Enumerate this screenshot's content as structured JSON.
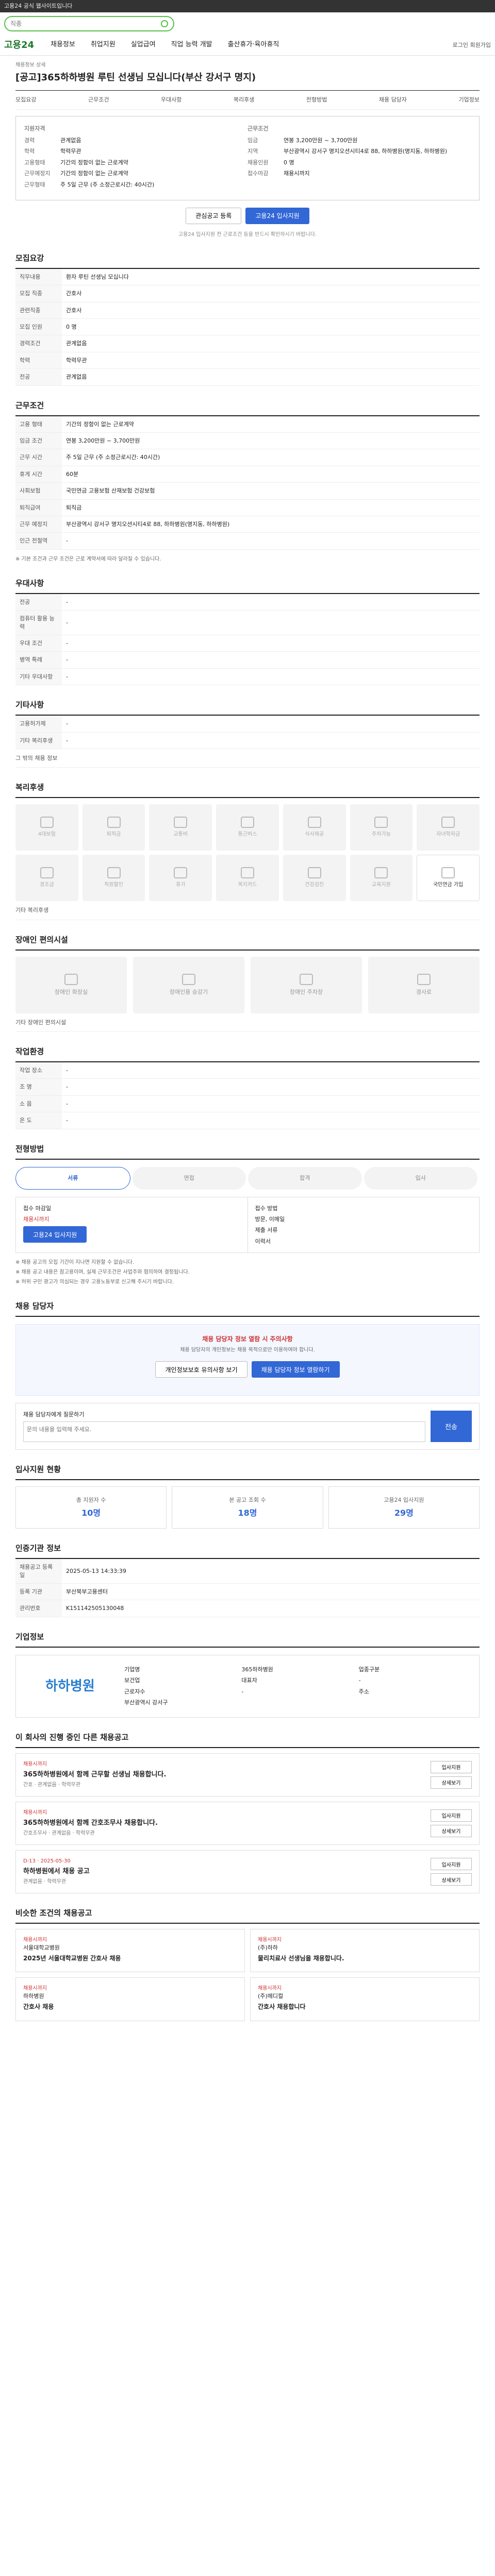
{
  "topbar": {
    "text": "고용24 공식 웹사이트입니다"
  },
  "search": {
    "placeholder": "직종"
  },
  "gnb": {
    "logo": "고용24",
    "menu": [
      "채용정보",
      "취업지원",
      "실업급여",
      "직업 능력 개발",
      "출산휴가·육아휴직"
    ],
    "right": "로그인 회원가입"
  },
  "job": {
    "category": "채용정보 상세",
    "title": "[공고]365하하병원 루틴 선생님 모십니다(부산 강서구 명지)",
    "tabs": [
      "모집요강",
      "근무조건",
      "우대사항",
      "복리후생",
      "전형방법",
      "채용 담당자",
      "기업정보"
    ]
  },
  "summary": {
    "left_title": "지원자격",
    "right_title": "근무조건",
    "left": [
      {
        "k": "경력",
        "v": "관계없음"
      },
      {
        "k": "학력",
        "v": "학력무관"
      },
      {
        "k": "고용형태",
        "v": "기간의 정함이 없는 근로계약"
      },
      {
        "k": "근무예정지",
        "v": "기간의 정함이 없는 근로계약"
      },
      {
        "k": "근무형태",
        "v": "주 5일 근무 (주 소정근로시간: 40시간)"
      }
    ],
    "right": [
      {
        "k": "임금",
        "v": "연봉 3,200만원 ~ 3,700만원"
      },
      {
        "k": "지역",
        "v": "부산광역시 강서구 명지오션시티4로 88, 하하병원(명지동, 하하병원)"
      },
      {
        "k": "채용인원",
        "v": "0 명"
      },
      {
        "k": "접수마감",
        "v": "채용시까지"
      }
    ]
  },
  "actions": {
    "scrap": "관심공고 등록",
    "apply": "고용24 입사지원"
  },
  "summary_note": "고용24 입사지원 전 근로조건 등을 반드시 확인하시기 바랍니다.",
  "recruit": {
    "heading": "모집요강",
    "rows": [
      {
        "k": "직무내용",
        "v": "환자 루틴 선생님 모십니다"
      },
      {
        "k": "모집 직종",
        "v": "간호사"
      },
      {
        "k": "관련직종",
        "v": "간호사"
      },
      {
        "k": "모집 인원",
        "v": "0 명"
      },
      {
        "k": "경력조건",
        "v": "관계없음"
      },
      {
        "k": "학력",
        "v": "학력무관"
      },
      {
        "k": "전공",
        "v": "관계없음"
      }
    ]
  },
  "conditions": {
    "heading": "근무조건",
    "rows": [
      {
        "k": "고용 형태",
        "v": "기간의 정함이 없는 근로계약"
      },
      {
        "k": "임금 조건",
        "v": "연봉 3,200만원 ~ 3,700만원"
      },
      {
        "k": "근무 시간",
        "v": "주 5일 근무 (주 소정근로시간: 40시간)"
      },
      {
        "k": "휴게 시간",
        "v": "60분"
      },
      {
        "k": "사회보험",
        "v": "국민연금 고용보험 산재보험 건강보험"
      },
      {
        "k": "퇴직급여",
        "v": "퇴직금"
      },
      {
        "k": "근무 예정지",
        "v": "부산광역시 강서구 명지오션시티4로 88, 하하병원(명지동, 하하병원)"
      },
      {
        "k": "인근 전철역",
        "v": "-"
      }
    ],
    "note": "※ 기본 조건과 근무 조건은 근로 계약서에 따라 달라질 수 있습니다."
  },
  "pref": {
    "heading": "우대사항",
    "rows": [
      {
        "k": "전공",
        "v": "-"
      },
      {
        "k": "컴퓨터 활용 능력",
        "v": "-"
      },
      {
        "k": "우대 조건",
        "v": "-"
      },
      {
        "k": "병역 특례",
        "v": "-"
      },
      {
        "k": "기타 우대사항",
        "v": "-"
      }
    ]
  },
  "other": {
    "heading": "기타사항",
    "rows": [
      {
        "k": "고용허가제",
        "v": "-"
      },
      {
        "k": "기타 복리후생",
        "v": "-"
      }
    ],
    "extra": "그 밖의 채용 정보"
  },
  "welfare": {
    "heading": "복리후생",
    "items": [
      "4대보험",
      "퇴직금",
      "교통비",
      "통근버스",
      "식사제공",
      "주차가능",
      "자녀학자금",
      "경조금",
      "직원할인",
      "휴가",
      "복지카드",
      "건강검진",
      "교육지원",
      "국민연금 가입"
    ],
    "note": "기타 복리후생"
  },
  "facility": {
    "heading": "장애인 편의시설",
    "items": [
      "장애인 화장실",
      "장애인용 승강기",
      "장애인 주차장",
      "경사로"
    ],
    "note": "기타 장애인 편의시설"
  },
  "env": {
    "heading": "작업환경",
    "rows": [
      {
        "k": "작업 장소",
        "v": "-"
      },
      {
        "k": "조 명",
        "v": "-"
      },
      {
        "k": "소 음",
        "v": "-"
      },
      {
        "k": "온 도",
        "v": "-"
      }
    ]
  },
  "process": {
    "heading": "전형방법",
    "steps": [
      "서류",
      "면접",
      "합격",
      "입사"
    ],
    "deadline_label": "접수 마감일",
    "deadline": "채용시까지",
    "method_label": "접수 방법",
    "method": "방문, 이메일",
    "docs_label": "제출 서류",
    "docs": "이력서",
    "apply": "고용24 입사지원"
  },
  "notes": [
    "※ 채용 공고의 모집 기간이 지나면 지원할 수 없습니다.",
    "※ 채용 공고 내용은 참고용이며, 실제 근무조건은 사업주와 협의하여 결정됩니다.",
    "※ 허위 구인 광고가 의심되는 경우 고용노동부로 신고해 주시기 바랍니다."
  ],
  "contact": {
    "heading": "채용 담당자",
    "title": "채용 담당자 정보 열람 시 주의사항",
    "desc": "채용 담당자의 개인정보는 채용 목적으로만 이용하여야 합니다.",
    "btn1": "개인정보보호 유의사항 보기",
    "btn2": "채용 담당자 정보 열람하기"
  },
  "inquiry": {
    "label": "채용 담당자에게 질문하기",
    "placeholder": "문의 내용을 입력해 주세요.",
    "send": "전송"
  },
  "stats": {
    "heading": "입사지원 현황",
    "items": [
      {
        "label": "총 지원자 수",
        "value": "10명"
      },
      {
        "label": "본 공고 조회 수",
        "value": "18명"
      },
      {
        "label": "고용24 입사지원",
        "value": "29명"
      }
    ]
  },
  "org": {
    "heading": "인증기관 정보",
    "rows": [
      {
        "k": "채용공고 등록일",
        "v": "2025-05-13 14:33:39"
      },
      {
        "k": "등록 기관",
        "v": "부산북부고용센터"
      },
      {
        "k": "관리번호",
        "v": "K151142505130048"
      }
    ]
  },
  "company": {
    "heading": "기업정보",
    "logo": "하하병원",
    "cells": [
      "기업명",
      "365하하병원",
      "업종구분",
      "보건업",
      "대표자",
      "-",
      "근로자수",
      "-",
      "주소",
      "부산광역시 강서구"
    ]
  },
  "others": {
    "heading": "이 회사의 진행 중인 다른 채용공고",
    "jobs": [
      {
        "badge": "채용시까지",
        "name": "365하하병원에서 함께 근무할 선생님 채용합니다.",
        "meta": "간호 · 관계없음 · 학력무관"
      },
      {
        "badge": "채용시까지",
        "name": "365하하병원에서 함께 간호조무사 채용합니다.",
        "meta": "간호조무사 · 관계없음 · 학력무관"
      },
      {
        "badge": "D-13 · 2025-05-30",
        "name": "하하병원에서 채용 공고",
        "meta": "관계없음 · 학력무관"
      }
    ],
    "btn_apply": "입사지원",
    "btn_detail": "상세보기"
  },
  "similar": {
    "heading": "비슷한 조건의 채용공고",
    "cards": [
      {
        "badge": "채용시까지",
        "org": "서울대학교병원",
        "name": "2025년 서울대학교병원 간호사 채용"
      },
      {
        "badge": "채용시까지",
        "org": "(주)하하",
        "name": "물리치료사 선생님을 채용합니다."
      },
      {
        "badge": "채용시까지",
        "org": "하하병원",
        "name": "간호사 채용"
      },
      {
        "badge": "채용시까지",
        "org": "(주)메디컬",
        "name": "간호사 채용합니다"
      }
    ]
  }
}
